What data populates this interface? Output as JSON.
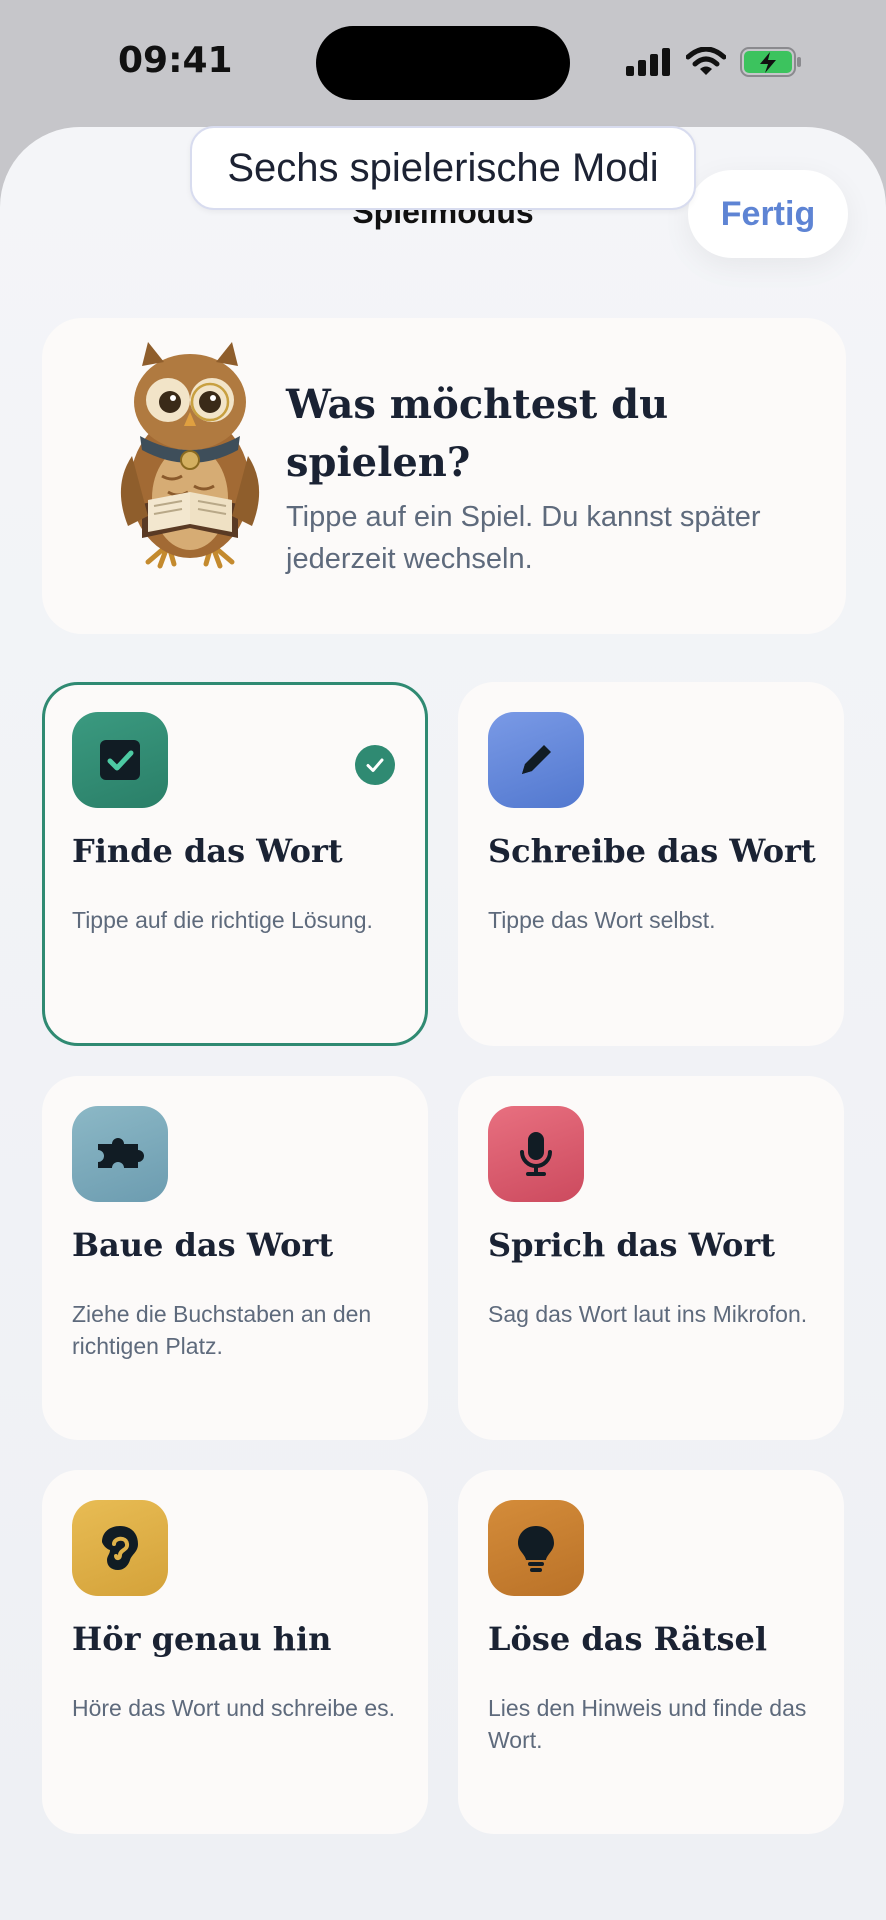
{
  "status": {
    "time": "09:41"
  },
  "header": {
    "tooltip": "Sechs spielerische Modi",
    "title": "Spielmodus",
    "done_label": "Fertig"
  },
  "hero": {
    "title": "Was möchtest du spielen?",
    "subtitle": "Tippe auf ein Spiel. Du kannst später jederzeit wechseln."
  },
  "modes": [
    {
      "title": "Finde das Wort",
      "desc": "Tippe auf die richtige Lösung.",
      "icon": "checkbox-icon",
      "color": "#2f8a72",
      "selected": true
    },
    {
      "title": "Schreibe das Wort",
      "desc": "Tippe das Wort selbst.",
      "icon": "pencil-icon",
      "color": "#6485d6",
      "selected": false
    },
    {
      "title": "Baue das Wort",
      "desc": "Ziehe die Buchstaben an den richtigen Platz.",
      "icon": "puzzle-icon",
      "color": "#7aa6b6",
      "selected": false
    },
    {
      "title": "Sprich das Wort",
      "desc": "Sag das Wort laut ins Mikrofon.",
      "icon": "microphone-icon",
      "color": "#d85a6c",
      "selected": false
    },
    {
      "title": "Hör genau hin",
      "desc": "Höre das Wort und schreibe es.",
      "icon": "ear-icon",
      "color": "#d9aa3c",
      "selected": false
    },
    {
      "title": "Löse das Rätsel",
      "desc": "Lies den Hinweis und finde das Wort.",
      "icon": "lightbulb-icon",
      "color": "#c57f2f",
      "selected": false
    }
  ]
}
